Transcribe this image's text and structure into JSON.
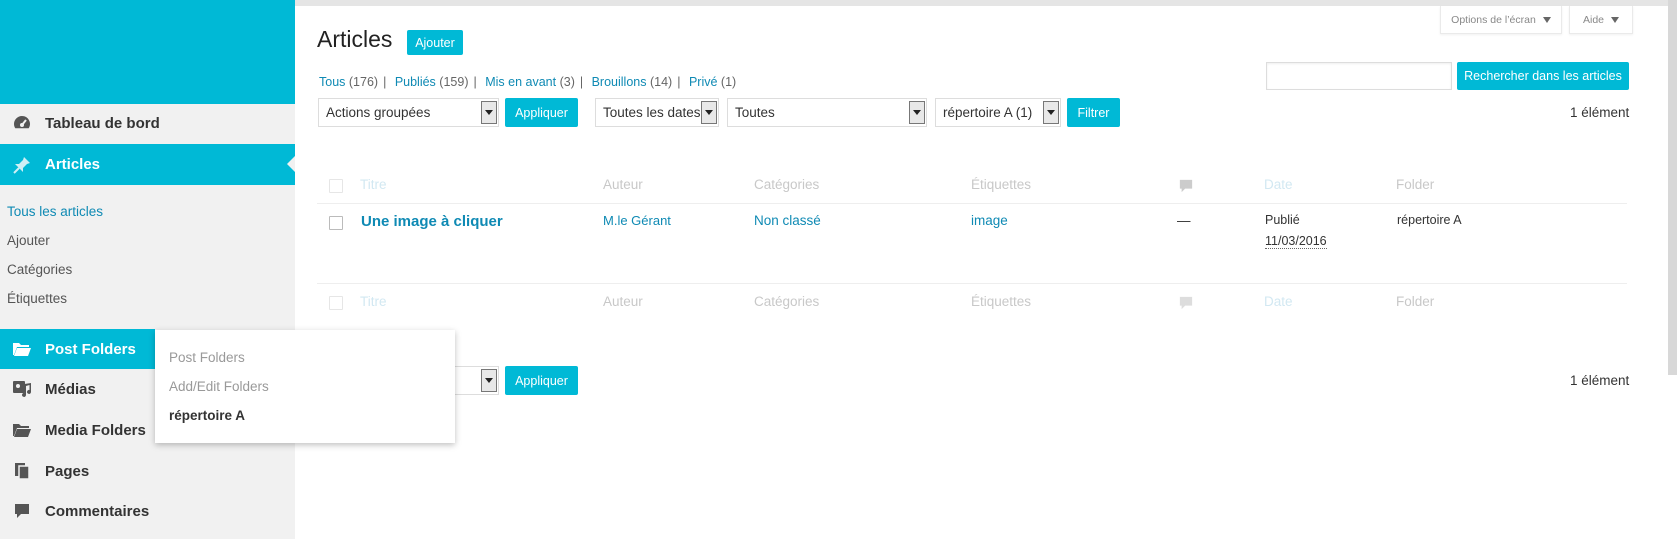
{
  "sidebar": {
    "menu": [
      {
        "label": "Tableau de bord",
        "icon": "dashboard-icon"
      },
      {
        "label": "Articles",
        "icon": "pin-icon"
      },
      {
        "label": "Post Folders",
        "icon": "folder-icon"
      },
      {
        "label": "Médias",
        "icon": "media-icon"
      },
      {
        "label": "Media Folders",
        "icon": "folder-icon"
      },
      {
        "label": "Pages",
        "icon": "pages-icon"
      },
      {
        "label": "Commentaires",
        "icon": "comment-icon"
      }
    ],
    "submenu": [
      "Tous les articles",
      "Ajouter",
      "Catégories",
      "Étiquettes"
    ]
  },
  "flyout": [
    "Post Folders",
    "Add/Edit Folders",
    "répertoire A"
  ],
  "screen_options": {
    "options_label": "Options de l’écran",
    "help_label": "Aide"
  },
  "header": {
    "title": "Articles",
    "add_button": "Ajouter"
  },
  "filters_links": [
    {
      "label": "Tous",
      "count": "(176)"
    },
    {
      "label": "Publiés",
      "count": "(159)"
    },
    {
      "label": "Mis en avant",
      "count": "(3)"
    },
    {
      "label": "Brouillons",
      "count": "(14)"
    },
    {
      "label": "Privé",
      "count": "(1)"
    }
  ],
  "search": {
    "button": "Rechercher dans les articles",
    "value": ""
  },
  "toolbar": {
    "bulk_actions": "Actions groupées",
    "apply": "Appliquer",
    "dates": "Toutes les dates",
    "categories": "Toutes",
    "folder": "répertoire A (1)",
    "filter": "Filtrer",
    "count": "1 élément"
  },
  "table": {
    "headers": {
      "title": "Titre",
      "author": "Auteur",
      "categories": "Catégories",
      "tags": "Étiquettes",
      "date": "Date",
      "folder": "Folder"
    },
    "rows": [
      {
        "title": "Une image à cliquer",
        "author": "M.le Gérant",
        "categories": "Non classé",
        "tags": "image",
        "comments": "—",
        "status": "Publié",
        "date": "11/03/2016",
        "folder": "répertoire A"
      }
    ]
  },
  "bottom_toolbar": {
    "apply": "Appliquer",
    "count": "1 élément"
  },
  "colors": {
    "accent": "#00b9d6",
    "link": "#0f8ab4",
    "sidebar_bg": "#f1f1f1"
  }
}
